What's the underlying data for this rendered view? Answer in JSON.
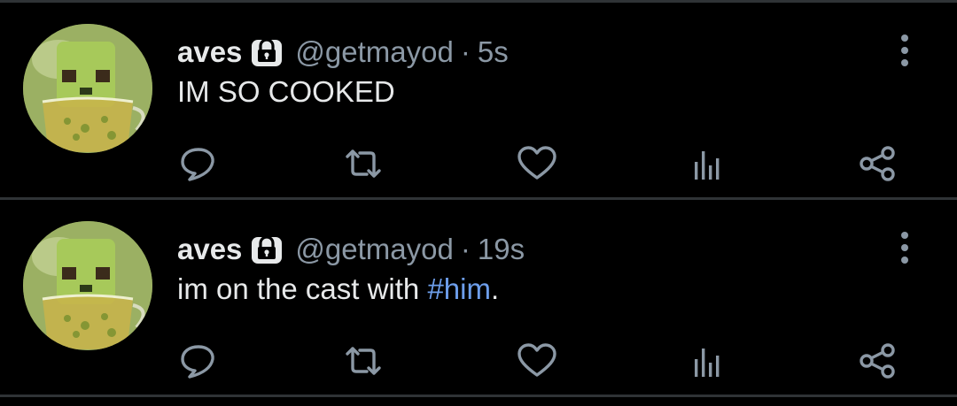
{
  "tweets": [
    {
      "display_name": "aves",
      "handle": "@getmayod",
      "separator": "·",
      "time": "5s",
      "text_plain": "IM SO COOKED",
      "text_hashtag": "",
      "text_suffix": ""
    },
    {
      "display_name": "aves",
      "handle": "@getmayod",
      "separator": "·",
      "time": "19s",
      "text_plain": "im on the cast with ",
      "text_hashtag": "#him",
      "text_suffix": "."
    }
  ],
  "icons": {
    "lock": "lock-icon",
    "more": "more-vertical-icon",
    "reply": "reply-icon",
    "retweet": "retweet-icon",
    "like": "heart-icon",
    "views": "analytics-icon",
    "share": "share-icon"
  },
  "colors": {
    "background": "#000000",
    "divider": "#2f3336",
    "primary_text": "#e7e9ea",
    "secondary_text": "#8b98a5",
    "hashtag": "#6d9eeb"
  }
}
